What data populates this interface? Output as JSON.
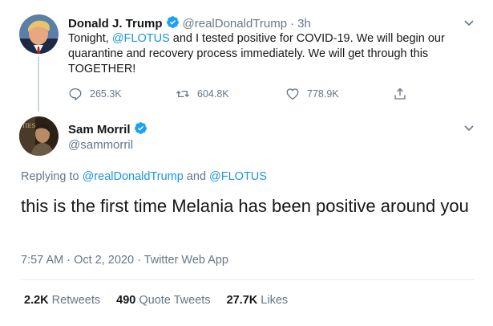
{
  "original_tweet": {
    "author_name": "Donald J. Trump",
    "author_handle": "@realDonaldTrump",
    "separator": "·",
    "time_ago": "3h",
    "text_part1": "Tonight, ",
    "text_mention": "@FLOTUS",
    "text_part2": " and I tested positive for COVID-19. We will begin our quarantine and recovery process immediately. We will get through this TOGETHER!",
    "replies": "265.3K",
    "retweets": "604.8K",
    "likes": "778.9K"
  },
  "reply_tweet": {
    "author_name": "Sam Morril",
    "author_handle": "@sammorril",
    "replying_prefix": "Replying to ",
    "replying_mention1": "@realDonaldTrump",
    "replying_and": " and ",
    "replying_mention2": "@FLOTUS",
    "text": "this is the first time Melania has been positive around you",
    "timestamp": "7:57 AM · Oct 2, 2020 · Twitter Web App",
    "stats": [
      {
        "count": "2.2K",
        "label": "Retweets"
      },
      {
        "count": "490",
        "label": "Quote Tweets"
      },
      {
        "count": "27.7K",
        "label": "Likes"
      }
    ]
  },
  "colors": {
    "link": "#1b95e0",
    "secondary_text": "#657786",
    "verified": "#1da1f2",
    "divider": "#e6ecf0"
  },
  "icons": {
    "verified": "verified-badge-icon",
    "reply": "reply-icon",
    "retweet": "retweet-icon",
    "like": "heart-icon",
    "share": "share-icon",
    "more": "chevron-down-icon"
  }
}
